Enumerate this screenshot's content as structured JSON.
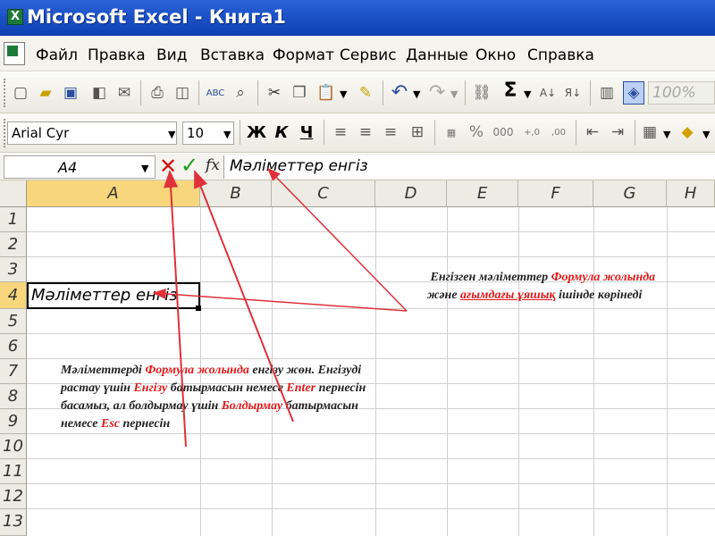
{
  "window": {
    "title": "Microsoft Excel - Книга1"
  },
  "menu": {
    "items": [
      "Файл",
      "Правка",
      "Вид",
      "Вставка",
      "Формат",
      "Сервис",
      "Данные",
      "Окно",
      "Справка"
    ]
  },
  "toolbar": {
    "zoom": "100%",
    "font_name": "Arial Cyr",
    "font_size": "10",
    "bold": "Ж",
    "italic": "К",
    "underline": "Ч",
    "sum": "Σ"
  },
  "formula_bar": {
    "name_box": "A4",
    "fx": "fx",
    "value": "Мәліметтер енгіз"
  },
  "grid": {
    "columns": [
      "A",
      "B",
      "C",
      "D",
      "E",
      "F",
      "G",
      "H"
    ],
    "rows": [
      "1",
      "2",
      "3",
      "4",
      "5",
      "6",
      "7",
      "8",
      "9",
      "10",
      "11",
      "12",
      "13"
    ],
    "active_cell_value": "Мәліметтер енгіз"
  },
  "annotations": {
    "note1": {
      "line1_a": "Енгізген мәліметтер ",
      "line1_b": "Формула жолында",
      "line2_a": "және ",
      "line2_b": "ағымдағы ұяшық",
      "line2_c": " ішінде көрінеді"
    },
    "note2": {
      "p1": "Мәліметтерді ",
      "p2": "Формула жолында",
      "p3": " енгізу жөн. Енгізуді растау үшін ",
      "p4": "Енгізу",
      "p5": " батырмасын немесе ",
      "p6": "Enter",
      "p7": " пернесін басамыз, ал болдырмау үшін ",
      "p8": "Болдырмау",
      "p9": " батырмасын немесе ",
      "p10": "Esc",
      "p11": " пернесін"
    }
  },
  "colors": {
    "title_bar": "#1a4fc4",
    "highlight_red": "#e01a1a",
    "active_header": "#f7d67c",
    "arrow": "#e0303a"
  }
}
